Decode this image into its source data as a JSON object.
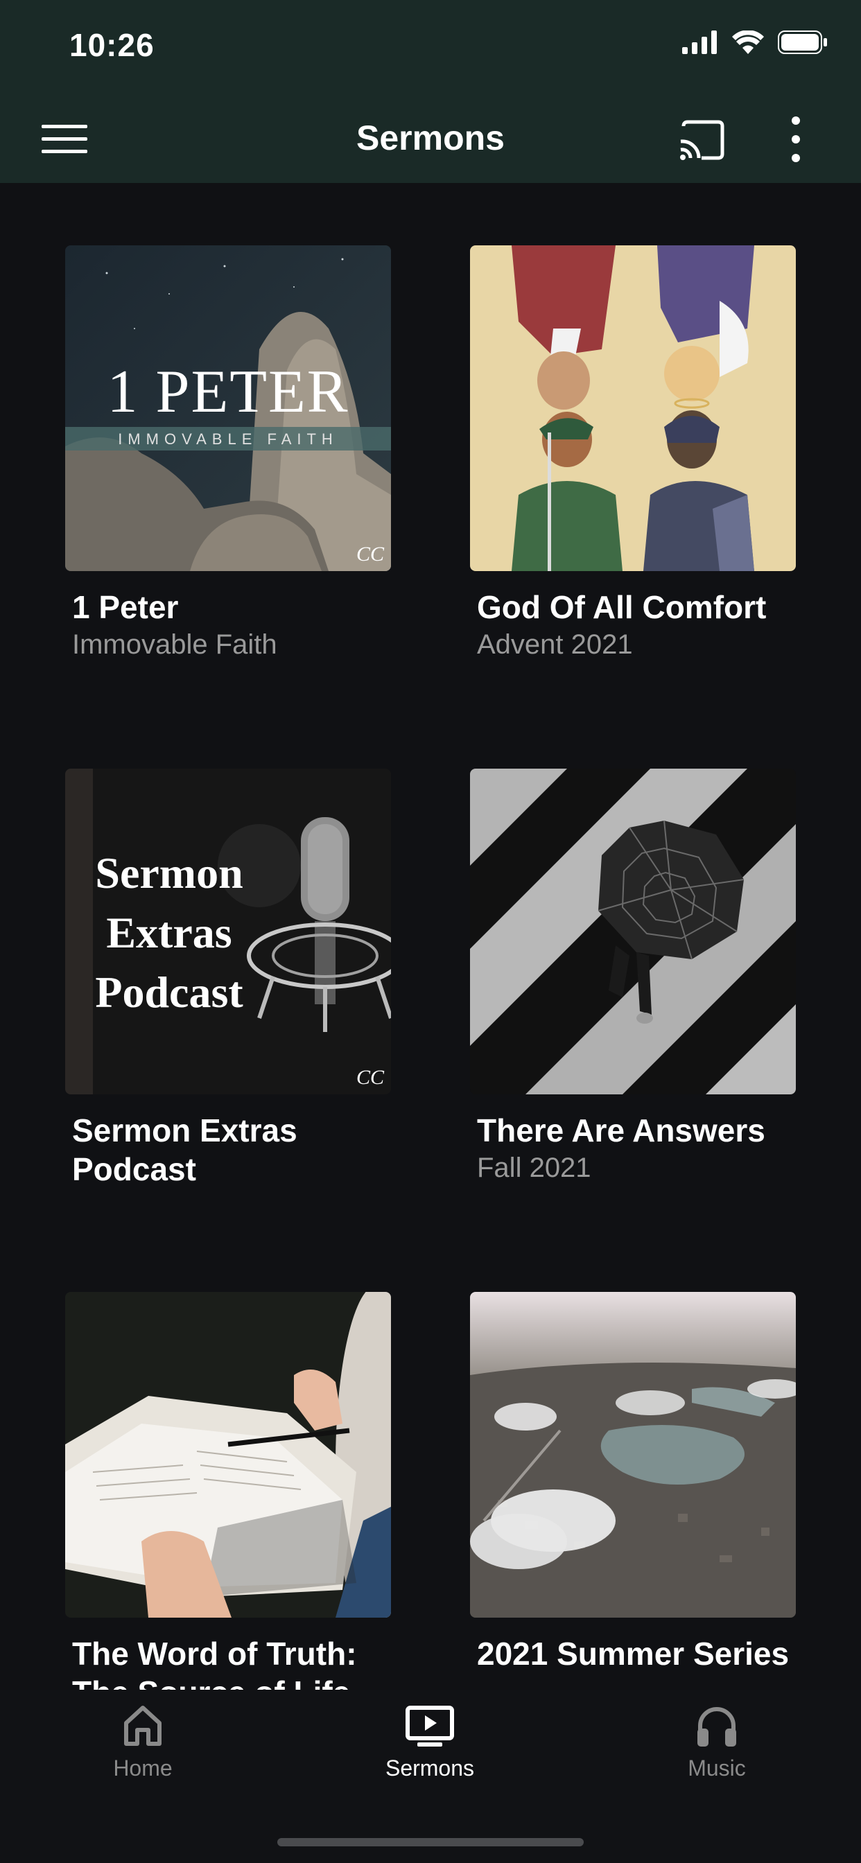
{
  "status_bar": {
    "time": "10:26"
  },
  "app_bar": {
    "title": "Sermons",
    "menu_icon": "hamburger-menu-icon",
    "cast_icon": "cast-icon",
    "more_icon": "more-vertical-icon"
  },
  "series": [
    {
      "title": "1 Peter",
      "subtitle": "Immovable Faith",
      "art_title": "1 PETER",
      "art_subtitle": "IMMOVABLE FAITH",
      "art_logo": "CC"
    },
    {
      "title": "God Of All Comfort",
      "subtitle": "Advent 2021"
    },
    {
      "title": "Sermon Extras Podcast",
      "subtitle": "",
      "art_title_lines": [
        "Sermon",
        "Extras",
        "Podcast"
      ],
      "art_logo": "CC"
    },
    {
      "title": "There Are Answers",
      "subtitle": "Fall 2021"
    },
    {
      "title": "The Word of Truth: The Source of Life",
      "subtitle": ""
    },
    {
      "title": "2021 Summer Series",
      "subtitle": ""
    }
  ],
  "tab_bar": {
    "tabs": [
      {
        "label": "Home",
        "icon": "home-icon"
      },
      {
        "label": "Sermons",
        "icon": "tv-play-icon",
        "active": true
      },
      {
        "label": "Music",
        "icon": "headphones-icon"
      }
    ]
  },
  "colors": {
    "header": "#1a2a27",
    "background": "#101114",
    "muted_text": "#9a9a9a"
  }
}
